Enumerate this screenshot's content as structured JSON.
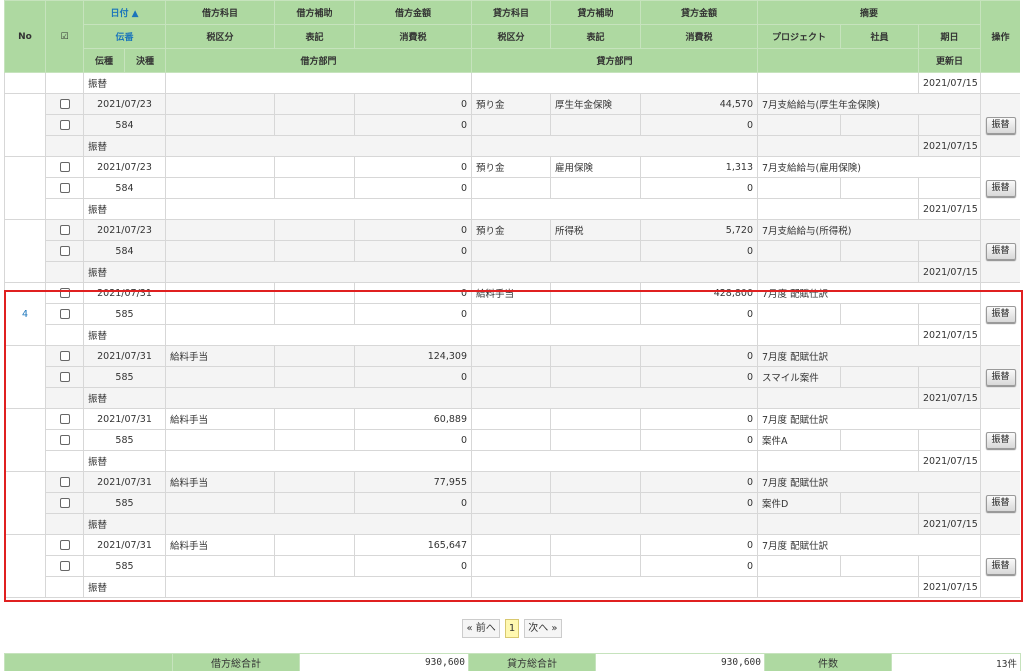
{
  "header": {
    "no": "No",
    "date": "日付 ▲",
    "slip": "伝番",
    "slip_type": "伝種",
    "close_type": "決種",
    "debit_account": "借方科目",
    "debit_sub": "借方補助",
    "debit_amount": "借方金額",
    "credit_account": "貸方科目",
    "credit_sub": "貸方補助",
    "credit_amount": "貸方金額",
    "summary": "摘要",
    "operation": "操作",
    "tax_class": "税区分",
    "notation": "表記",
    "consumption_tax": "消費税",
    "credit_tax_class": "税区分",
    "credit_notation": "表記",
    "credit_consumption_tax": "消費税",
    "project": "プロジェクト",
    "employee": "社員",
    "due_date": "期日",
    "debit_dept": "借方部門",
    "credit_dept": "貸方部門",
    "updated": "更新日"
  },
  "top_row": {
    "type": "振替",
    "updated": "2021/07/15"
  },
  "entries": [
    {
      "date": "2021/07/23",
      "slip": "584",
      "type": "振替",
      "debit_account": "",
      "debit_amount": "0",
      "debit_tax": "0",
      "credit_account": "預り金",
      "credit_sub": "厚生年金保険",
      "credit_amount": "44,570",
      "credit_tax": "0",
      "summary": "7月支給給与(厚生年金保険)",
      "project": "",
      "updated": "2021/07/15",
      "action": "振替"
    },
    {
      "date": "2021/07/23",
      "slip": "584",
      "type": "振替",
      "debit_account": "",
      "debit_amount": "0",
      "debit_tax": "0",
      "credit_account": "預り金",
      "credit_sub": "雇用保険",
      "credit_amount": "1,313",
      "credit_tax": "0",
      "summary": "7月支給給与(雇用保険)",
      "project": "",
      "updated": "2021/07/15",
      "action": "振替"
    },
    {
      "date": "2021/07/23",
      "slip": "584",
      "type": "振替",
      "debit_account": "",
      "debit_amount": "0",
      "debit_tax": "0",
      "credit_account": "預り金",
      "credit_sub": "所得税",
      "credit_amount": "5,720",
      "credit_tax": "0",
      "summary": "7月支給給与(所得税)",
      "project": "",
      "updated": "2021/07/15",
      "action": "振替"
    },
    {
      "no": "4",
      "date": "2021/07/31",
      "slip": "585",
      "type": "振替",
      "debit_account": "",
      "debit_amount": "0",
      "debit_tax": "0",
      "credit_account": "給料手当",
      "credit_sub": "",
      "credit_amount": "428,800",
      "credit_tax": "0",
      "summary": "7月度 配賦仕訳",
      "project": "",
      "updated": "2021/07/15",
      "action": "振替"
    },
    {
      "date": "2021/07/31",
      "slip": "585",
      "type": "振替",
      "debit_account": "給料手当",
      "debit_amount": "124,309",
      "debit_tax": "0",
      "credit_account": "",
      "credit_sub": "",
      "credit_amount": "0",
      "credit_tax": "0",
      "summary": "7月度 配賦仕訳",
      "project": "スマイル案件",
      "updated": "2021/07/15",
      "action": "振替"
    },
    {
      "date": "2021/07/31",
      "slip": "585",
      "type": "振替",
      "debit_account": "給料手当",
      "debit_amount": "60,889",
      "debit_tax": "0",
      "credit_account": "",
      "credit_sub": "",
      "credit_amount": "0",
      "credit_tax": "0",
      "summary": "7月度 配賦仕訳",
      "project": "案件A",
      "updated": "2021/07/15",
      "action": "振替"
    },
    {
      "date": "2021/07/31",
      "slip": "585",
      "type": "振替",
      "debit_account": "給料手当",
      "debit_amount": "77,955",
      "debit_tax": "0",
      "credit_account": "",
      "credit_sub": "",
      "credit_amount": "0",
      "credit_tax": "0",
      "summary": "7月度 配賦仕訳",
      "project": "案件D",
      "updated": "2021/07/15",
      "action": "振替"
    },
    {
      "date": "2021/07/31",
      "slip": "585",
      "type": "振替",
      "debit_account": "給料手当",
      "debit_amount": "165,647",
      "debit_tax": "0",
      "credit_account": "",
      "credit_sub": "",
      "credit_amount": "0",
      "credit_tax": "0",
      "summary": "7月度 配賦仕訳",
      "project": "",
      "updated": "2021/07/15",
      "action": "振替"
    }
  ],
  "pager": {
    "prev": "« 前へ",
    "current": "1",
    "next": "次へ »"
  },
  "totals": {
    "debit_label": "借方総合計",
    "debit_value": "930,600",
    "credit_label": "貸方総合計",
    "credit_value": "930,600",
    "count_label": "件数",
    "count_value": "13件"
  },
  "colors": {
    "header_bg": "#aed9a1",
    "link": "#1b75bb",
    "highlight": "#e02020"
  }
}
